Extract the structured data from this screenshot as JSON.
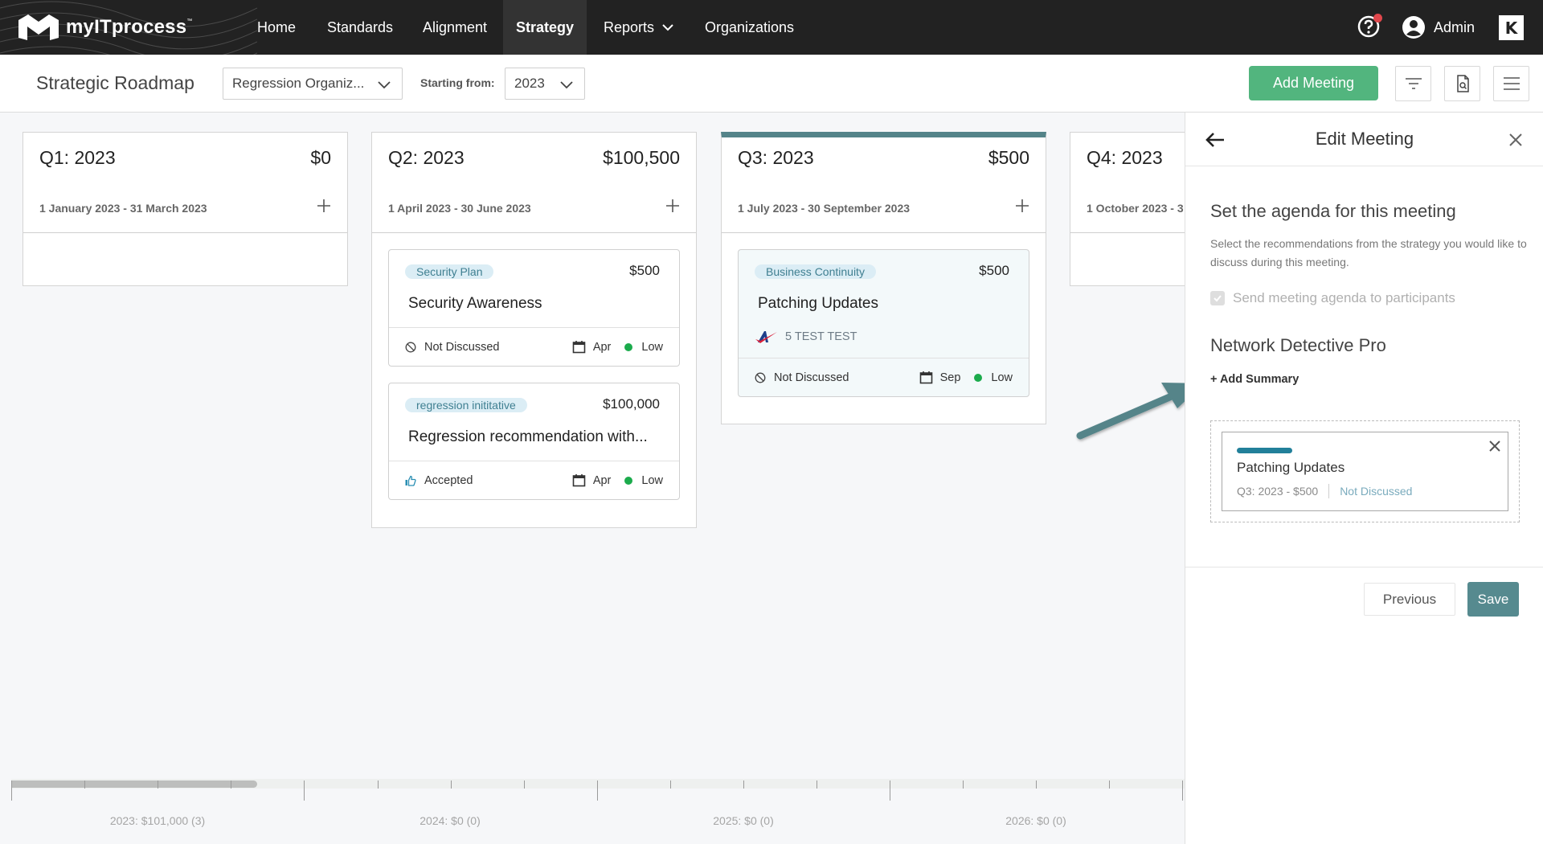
{
  "nav": {
    "brand": "myITprocess",
    "brand_tm": "™",
    "items": [
      {
        "label": "Home"
      },
      {
        "label": "Standards"
      },
      {
        "label": "Alignment"
      },
      {
        "label": "Strategy",
        "active": true
      },
      {
        "label": "Reports",
        "has_dropdown": true
      },
      {
        "label": "Organizations"
      }
    ],
    "user_label": "Admin",
    "app_switch_label": "K",
    "help_has_notification": true
  },
  "subheader": {
    "title": "Strategic Roadmap",
    "organization_select": "Regression Organiz...",
    "starting_from_label": "Starting from:",
    "year_select": "2023",
    "add_meeting_label": "Add Meeting"
  },
  "columns": [
    {
      "title": "Q1: 2023",
      "amount": "$0",
      "dates": "1 January 2023 - 31 March 2023",
      "cards": []
    },
    {
      "title": "Q2: 2023",
      "amount": "$100,500",
      "dates": "1 April 2023 - 30 June 2023",
      "cards": [
        {
          "tag": "Security Plan",
          "amount": "$500",
          "title": "Security Awareness",
          "status": "Not Discussed",
          "month": "Apr",
          "priority": "Low"
        },
        {
          "tag": "regression inititative",
          "amount": "$100,000",
          "title": "Regression recommendation with...",
          "status": "Accepted",
          "month": "Apr",
          "priority": "Low"
        }
      ]
    },
    {
      "title": "Q3: 2023",
      "amount": "$500",
      "dates": "1 July 2023 - 30 September 2023",
      "selected": true,
      "cards": [
        {
          "tag": "Business Continuity",
          "amount": "$500",
          "title": "Patching Updates",
          "organization": "5 TEST TEST",
          "status": "Not Discussed",
          "month": "Sep",
          "priority": "Low"
        }
      ]
    },
    {
      "title": "Q4: 2023",
      "amount": "",
      "dates": "1 October 2023 - 3",
      "cards": []
    }
  ],
  "timeline": {
    "labels": [
      "2023: $101,000 (3)",
      "2024: $0 (0)",
      "2025: $0 (0)",
      "2026: $0 (0)"
    ],
    "visible_window_fraction": 0.84
  },
  "panel": {
    "title": "Edit Meeting",
    "section_title": "Set the agenda for this meeting",
    "section_desc": "Select the recommendations from the strategy you would like to discuss during this meeting.",
    "send_agenda_label": "Send meeting agenda to participants",
    "send_agenda_checked": true,
    "org_title": "Network Detective Pro",
    "add_summary_label": "+ Add Summary",
    "agenda_items": [
      {
        "title": "Patching Updates",
        "meta": "Q3: 2023 - $500",
        "status": "Not Discussed"
      }
    ],
    "previous_label": "Previous",
    "save_label": "Save"
  },
  "colors": {
    "nav_bg": "#222222",
    "accent_green": "#52b57e",
    "accent_teal": "#568a8f",
    "tag_bg": "#dbedf5",
    "priority_low": "#1bab4c"
  }
}
